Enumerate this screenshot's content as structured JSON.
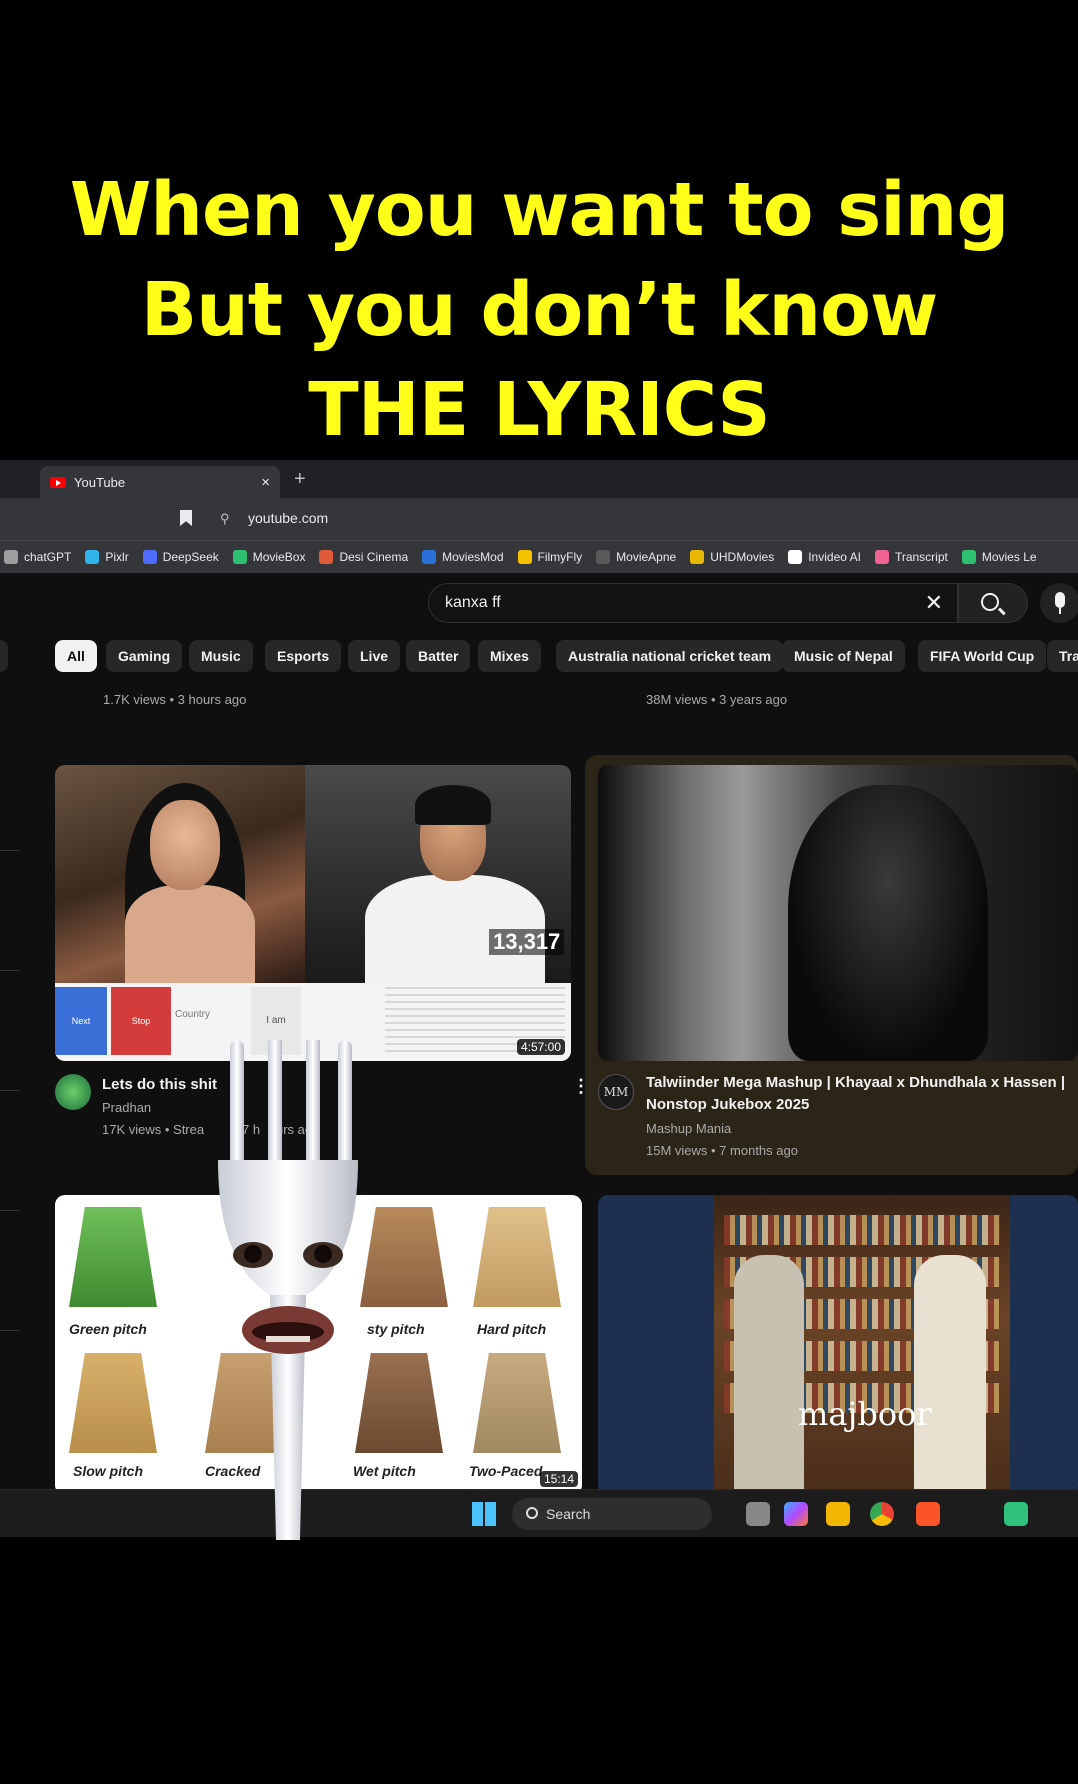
{
  "caption": {
    "line1": "When you want to sing",
    "line2": "But you don’t know",
    "line3": "THE LYRICS"
  },
  "browser": {
    "tab_title": "YouTube",
    "tab_close": "×",
    "new_tab": "+",
    "url": "youtube.com",
    "bookmarks": [
      {
        "label": "chatGPT",
        "color": "#9e9e9e"
      },
      {
        "label": "Pixlr",
        "color": "#2fb5e8"
      },
      {
        "label": "DeepSeek",
        "color": "#4d6bfe"
      },
      {
        "label": "MovieBox",
        "color": "#2fbf71"
      },
      {
        "label": "Desi Cinema",
        "color": "#e05a3a"
      },
      {
        "label": "MoviesMod",
        "color": "#2b6fd8"
      },
      {
        "label": "FilmyFly",
        "color": "#f2c200"
      },
      {
        "label": "MovieApne",
        "color": "#5a5a5a"
      },
      {
        "label": "UHDMovies",
        "color": "#e8b800"
      },
      {
        "label": "Invideo AI",
        "color": "#ffffff"
      },
      {
        "label": "Transcript",
        "color": "#f06292"
      },
      {
        "label": "Movies Le",
        "color": "#2fbf71"
      }
    ]
  },
  "youtube": {
    "search_query": "kanxa ff",
    "search_clear": "✕",
    "chips": [
      "All",
      "Gaming",
      "Music",
      "Esports",
      "Live",
      "Batter",
      "Mixes",
      "Australia national cricket team",
      "Music of Nepal",
      "FIFA World Cup",
      "Tra"
    ],
    "top_meta_left": "1.7K views • 3 hours ago",
    "top_meta_right": "38M views • 3 years ago",
    "videos": [
      {
        "title": "Lets do this shit",
        "channel": "Pradhan",
        "meta": "17K views • Strea",
        "meta_tail": "7 h",
        "meta_tail2": "urs ago",
        "duration": "4:57:00",
        "viewer_count": "13,317",
        "overlay_next": "Next",
        "overlay_stop": "Stop",
        "overlay_country": "Country",
        "overlay_iam": "I am"
      },
      {
        "title": "Talwiinder Mega Mashup | Khayaal x  Dhundhala x Hassen | Nonstop Jukebox 2025",
        "channel": "Mashup Mania",
        "meta": "15M views • 7 months ago",
        "avatar_text": "MM"
      },
      {
        "duration": "15:14",
        "pitches": [
          "Green pitch",
          "sty pitch",
          "Hard pitch",
          "Slow pitch",
          "Cracked",
          "Wet pitch",
          "Two-Paced"
        ]
      },
      {
        "thumb_text": "majboor"
      }
    ]
  },
  "taskbar": {
    "search_label": "Search"
  }
}
